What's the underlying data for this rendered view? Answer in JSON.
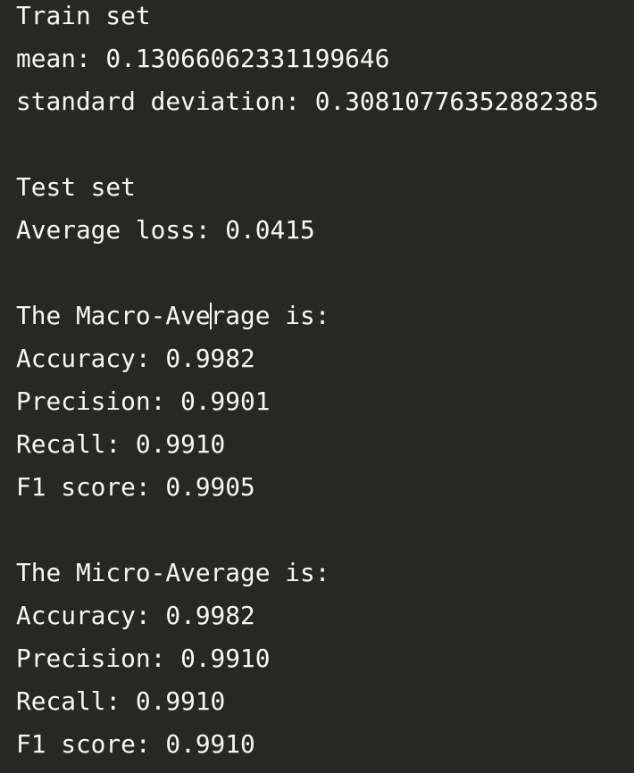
{
  "train": {
    "heading": "Train set",
    "mean": "mean: 0.13066062331199646",
    "std": "standard deviation: 0.30810776352882385"
  },
  "test": {
    "heading": "Test set",
    "avg_loss": "Average loss: 0.0415"
  },
  "macro": {
    "heading_before_caret": "The Macro-Ave",
    "heading_after_caret": "rage is:",
    "accuracy": "Accuracy: 0.9982",
    "precision": "Precision: 0.9901",
    "recall": "Recall: 0.9910",
    "f1": "F1 score: 0.9905"
  },
  "micro": {
    "heading": "The Micro-Average is:",
    "accuracy": "Accuracy: 0.9982",
    "precision": "Precision: 0.9910",
    "recall": "Recall: 0.9910",
    "f1": "F1 score: 0.9910"
  },
  "colors": {
    "background": "#272822",
    "text": "#f8f8f2"
  }
}
